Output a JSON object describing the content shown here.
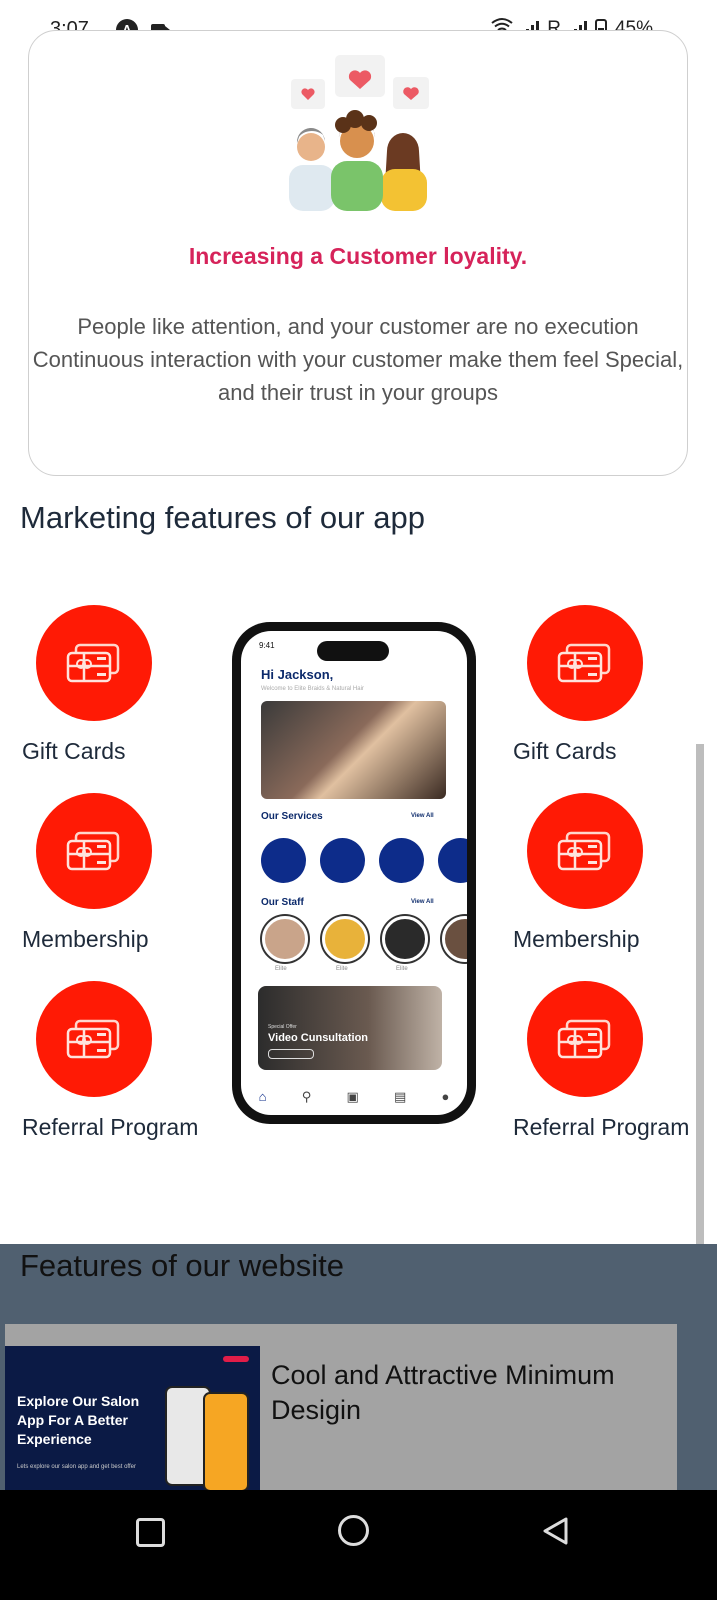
{
  "status_bar": {
    "time": "3:07",
    "carrier_r": "R",
    "battery": "45%",
    "icons": [
      "a-icon",
      "video-record-icon",
      "wifi-icon",
      "signal-icon",
      "battery-icon"
    ]
  },
  "loyalty_card": {
    "title": "Increasing a Customer loyality.",
    "description": "People like attention, and your customer are no execution Continuous interaction with your customer make them feel Special, and their trust in your groups",
    "title_color": "#d6235a"
  },
  "marketing": {
    "heading": "Marketing features of our app",
    "accent_color": "#ff1a05",
    "left_features": [
      {
        "label": "Gift Cards",
        "icon": "gift-card-icon"
      },
      {
        "label": "Membership",
        "icon": "gift-card-icon"
      },
      {
        "label": "Referral Program",
        "icon": "gift-card-icon"
      }
    ],
    "right_features": [
      {
        "label": "Gift Cards",
        "icon": "gift-card-icon"
      },
      {
        "label": "Membership",
        "icon": "gift-card-icon"
      },
      {
        "label": "Referral Program",
        "icon": "gift-card-icon"
      }
    ]
  },
  "phone_mockup": {
    "time": "9:41",
    "greeting": "Hi Jackson,",
    "welcome": "Welcome to Elite Braids & Natural Hair",
    "services_heading": "Our Services",
    "staff_heading": "Our Staff",
    "view_all": "View All",
    "staff_names": [
      "Elite",
      "Elite",
      "Elite"
    ],
    "offer_small": "Special Offer",
    "offer_title": "Video Cunsultation",
    "nav_items": [
      "home-icon",
      "location-icon",
      "book-now-icon",
      "appointment-icon",
      "account-icon"
    ]
  },
  "website": {
    "heading": "Features of our website",
    "card_text": "Cool and Attractive Minimum Desigin",
    "thumb_text": "Explore Our Salon App For A Better Experience",
    "thumb_sub": "Lets explore our salon app and get best offer"
  },
  "nav_bar": {
    "icons": [
      "recents-square-icon",
      "home-circle-icon",
      "back-triangle-icon"
    ]
  }
}
